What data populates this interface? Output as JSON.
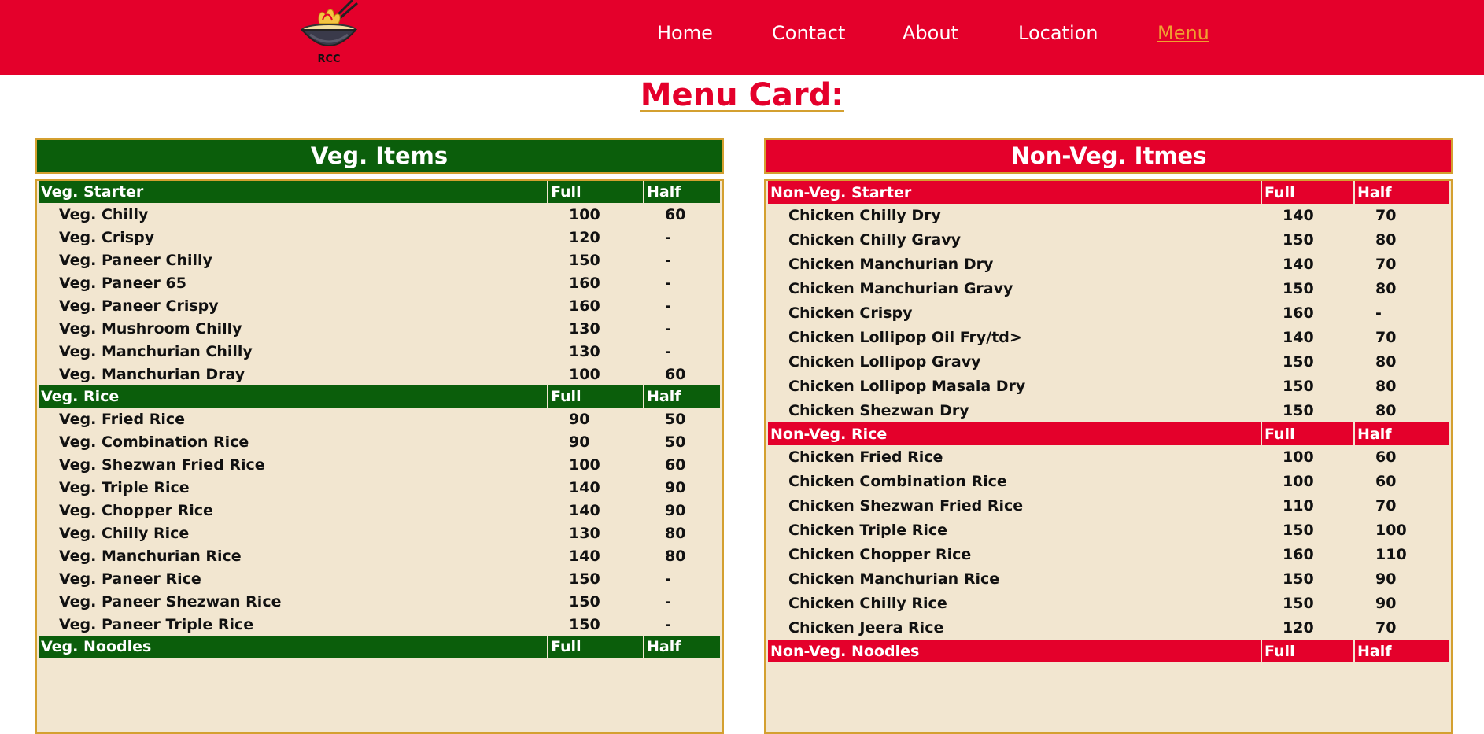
{
  "header": {
    "logo_text": "RCC",
    "nav": [
      {
        "label": "Home",
        "active": false
      },
      {
        "label": "Contact",
        "active": false
      },
      {
        "label": "About",
        "active": false
      },
      {
        "label": "Location",
        "active": false
      },
      {
        "label": "Menu",
        "active": true
      }
    ]
  },
  "page_title": "Menu Card:",
  "veg": {
    "title": "Veg. Items",
    "color": "#0b5e0b",
    "sections": [
      {
        "name": "Veg. Starter",
        "full_label": "Full",
        "half_label": "Half",
        "items": [
          {
            "name": "Veg. Chilly",
            "full": "100",
            "half": "60"
          },
          {
            "name": "Veg. Crispy",
            "full": "120",
            "half": "-"
          },
          {
            "name": "Veg. Paneer Chilly",
            "full": "150",
            "half": "-"
          },
          {
            "name": "Veg. Paneer 65",
            "full": "160",
            "half": "-"
          },
          {
            "name": "Veg. Paneer Crispy",
            "full": "160",
            "half": "-"
          },
          {
            "name": "Veg. Mushroom Chilly",
            "full": "130",
            "half": "-"
          },
          {
            "name": "Veg. Manchurian Chilly",
            "full": "130",
            "half": "-"
          },
          {
            "name": "Veg. Manchurian Dray",
            "full": "100",
            "half": "60"
          }
        ]
      },
      {
        "name": "Veg. Rice",
        "full_label": "Full",
        "half_label": "Half",
        "items": [
          {
            "name": "Veg. Fried Rice",
            "full": "90",
            "half": "50"
          },
          {
            "name": "Veg. Combination Rice",
            "full": "90",
            "half": "50"
          },
          {
            "name": "Veg. Shezwan Fried Rice",
            "full": "100",
            "half": "60"
          },
          {
            "name": "Veg. Triple Rice",
            "full": "140",
            "half": "90"
          },
          {
            "name": "Veg. Chopper Rice",
            "full": "140",
            "half": "90"
          },
          {
            "name": "Veg. Chilly Rice",
            "full": "130",
            "half": "80"
          },
          {
            "name": "Veg. Manchurian Rice",
            "full": "140",
            "half": "80"
          },
          {
            "name": "Veg. Paneer Rice",
            "full": "150",
            "half": "-"
          },
          {
            "name": "Veg. Paneer Shezwan Rice",
            "full": "150",
            "half": "-"
          },
          {
            "name": "Veg. Paneer Triple Rice",
            "full": "150",
            "half": "-"
          }
        ]
      },
      {
        "name": "Veg. Noodles",
        "full_label": "Full",
        "half_label": "Half",
        "items": []
      }
    ]
  },
  "nonveg": {
    "title": "Non-Veg. Itmes",
    "color": "#e4002b",
    "sections": [
      {
        "name": "Non-Veg. Starter",
        "full_label": "Full",
        "half_label": "Half",
        "items": [
          {
            "name": "Chicken Chilly Dry",
            "full": "140",
            "half": "70"
          },
          {
            "name": "Chicken Chilly Gravy",
            "full": "150",
            "half": "80"
          },
          {
            "name": "Chicken Manchurian Dry",
            "full": "140",
            "half": "70"
          },
          {
            "name": "Chicken Manchurian Gravy",
            "full": "150",
            "half": "80"
          },
          {
            "name": "Chicken Crispy",
            "full": "160",
            "half": "-"
          },
          {
            "name": "Chicken Lollipop Oil Fry/td>",
            "full": "140",
            "half": "70"
          },
          {
            "name": "Chicken Lollipop Gravy",
            "full": "150",
            "half": "80"
          },
          {
            "name": "Chicken Lollipop Masala Dry",
            "full": "150",
            "half": "80"
          },
          {
            "name": "Chicken Shezwan Dry",
            "full": "150",
            "half": "80"
          }
        ]
      },
      {
        "name": "Non-Veg. Rice",
        "full_label": "Full",
        "half_label": "Half",
        "items": [
          {
            "name": "Chicken Fried Rice",
            "full": "100",
            "half": "60"
          },
          {
            "name": "Chicken Combination Rice",
            "full": "100",
            "half": "60"
          },
          {
            "name": "Chicken Shezwan Fried Rice",
            "full": "110",
            "half": "70"
          },
          {
            "name": "Chicken Triple Rice",
            "full": "150",
            "half": "100"
          },
          {
            "name": "Chicken Chopper Rice",
            "full": "160",
            "half": "110"
          },
          {
            "name": "Chicken Manchurian Rice",
            "full": "150",
            "half": "90"
          },
          {
            "name": "Chicken Chilly Rice",
            "full": "150",
            "half": "90"
          },
          {
            "name": "Chicken Jeera Rice",
            "full": "120",
            "half": "70"
          }
        ]
      },
      {
        "name": "Non-Veg. Noodles",
        "full_label": "Full",
        "half_label": "Half",
        "items": []
      }
    ]
  }
}
